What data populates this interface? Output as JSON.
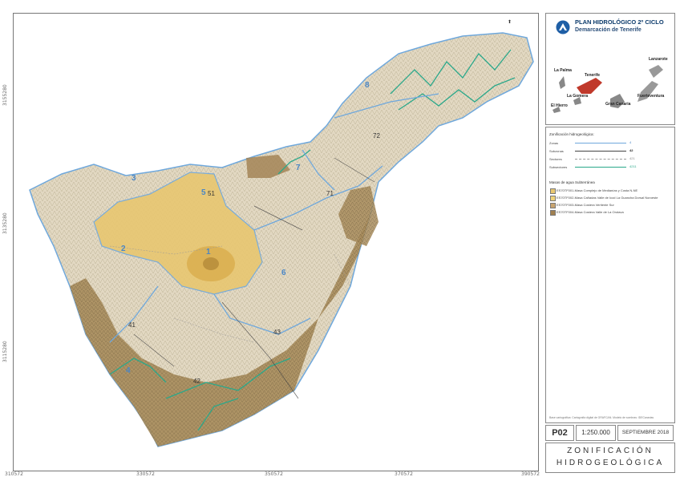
{
  "map": {
    "coord_bottom": [
      "310572",
      "330572",
      "350572",
      "370572",
      "390572"
    ],
    "coord_left": [
      "3155280",
      "3135280",
      "3115280"
    ],
    "zones": [
      {
        "id": "1",
        "label": "1"
      },
      {
        "id": "2",
        "label": "2"
      },
      {
        "id": "3",
        "label": "3"
      },
      {
        "id": "4",
        "label": "4"
      },
      {
        "id": "5",
        "label": "5"
      },
      {
        "id": "6",
        "label": "6"
      },
      {
        "id": "7",
        "label": "7"
      },
      {
        "id": "8",
        "label": "8"
      }
    ],
    "subzones": [
      "41",
      "42",
      "43",
      "51",
      "71",
      "72"
    ],
    "colors": {
      "zone_line": "#6fa8dc",
      "river": "#2aa88a",
      "mass1": "#e8c770",
      "mass3": "#c8a470",
      "mass4": "#a08050",
      "relief": "#d8cdb4",
      "sea": "#ffffff"
    }
  },
  "header": {
    "title": "PLAN HIDROLÓGICO 2º CICLO",
    "subtitle": "Demarcación de Tenerife"
  },
  "islands": [
    "La Palma",
    "Tenerife",
    "La Gomera",
    "El Hierro",
    "Gran Canaria",
    "Lanzarote",
    "Fuerteventura"
  ],
  "legend": {
    "heading": "Zonificación hidrogeológica:",
    "rows": [
      {
        "label": "Zonas",
        "value": "4"
      },
      {
        "label": "Subzonas",
        "value": "42"
      },
      {
        "label": "Sectores",
        "value": "421"
      },
      {
        "label": "Subsectores",
        "value": "4211"
      }
    ],
    "mass_heading": "Masas de agua Subterránea",
    "masses": [
      {
        "label": "ES70TF001-Masa Complejo de Medianías y Costa N-NE",
        "color": "#e8c770"
      },
      {
        "label": "ES70TF002-Masa Cañadas Valle de Icod La Guancha Dorsal Noroeste",
        "color": "#efd27a"
      },
      {
        "label": "ES70TF003-Masa Costera Vertiente Sur",
        "color": "#c8a470"
      },
      {
        "label": "ES70TF004-Masa Costera Valle de La Orotava",
        "color": "#a08050"
      }
    ],
    "credits": "Base cartográfica: Cartografía digital de GRAFCAN. Modelo de sombras: IDECanarias"
  },
  "footer": {
    "code": "P02",
    "scale": "1:250.000",
    "date": "SEPTIEMBRE 2018",
    "name_line1": "ZONIFICACIÓN",
    "name_line2": "HIDROGEOLÓGICA"
  }
}
